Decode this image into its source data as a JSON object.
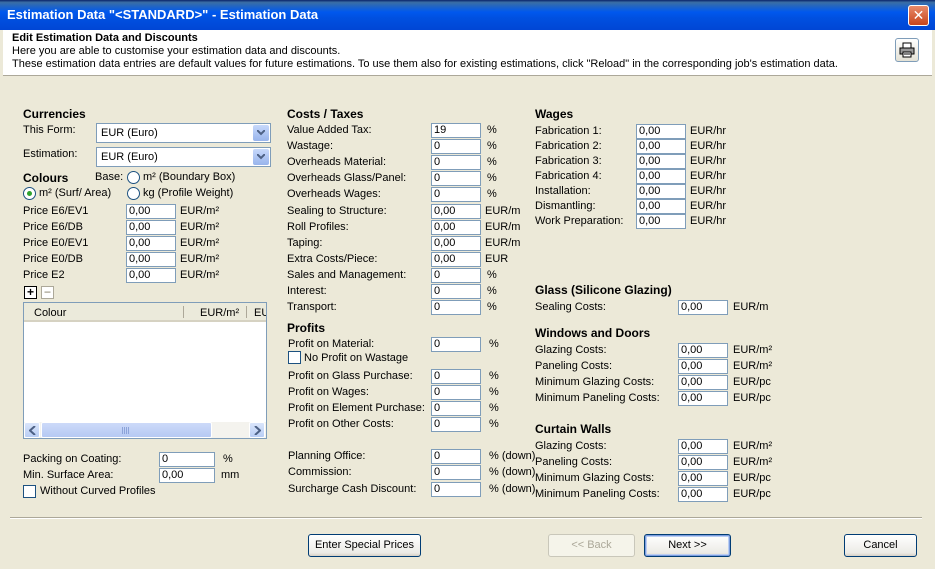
{
  "window": {
    "title": "Estimation Data \"<STANDARD>\" - Estimation Data",
    "close_glyph": "✕"
  },
  "header": {
    "title": "Edit Estimation Data and Discounts",
    "line1": "Here you are able to customise your estimation data and discounts.",
    "line2": "These estimation data entries are default values for future estimations. To use them also for existing estimations, click \"Reload\" in the corresponding job's estimation data."
  },
  "currencies": {
    "heading": "Currencies",
    "this_form_label": "This Form:",
    "this_form_value": "EUR (Euro)",
    "estimation_label": "Estimation:",
    "estimation_value": "EUR (Euro)"
  },
  "colours": {
    "heading": "Colours",
    "base_label": "Base:",
    "opt_boundary_box": "m² (Boundary Box)",
    "opt_surf_area": "m² (Surf/ Area)",
    "opt_profile_weight": "kg (Profile Weight)",
    "selected": "m² (Surf/ Area)",
    "prices": [
      {
        "label": "Price E6/EV1",
        "value": "0,00",
        "unit": "EUR/m²"
      },
      {
        "label": "Price E6/DB",
        "value": "0,00",
        "unit": "EUR/m²"
      },
      {
        "label": "Price E0/EV1",
        "value": "0,00",
        "unit": "EUR/m²"
      },
      {
        "label": "Price E0/DB",
        "value": "0,00",
        "unit": "EUR/m²"
      },
      {
        "label": "Price E2",
        "value": "0,00",
        "unit": "EUR/m²"
      }
    ],
    "add_glyph": "+",
    "remove_glyph": "−",
    "list_columns": [
      "Colour",
      "EUR/m²",
      "EU"
    ],
    "packing_label": "Packing on Coating:",
    "packing_value": "0",
    "packing_unit": "%",
    "min_surface_label": "Min. Surface Area:",
    "min_surface_value": "0,00",
    "min_surface_unit": "mm",
    "without_curved_label": "Without Curved Profiles"
  },
  "costs": {
    "heading": "Costs / Taxes",
    "rows": [
      {
        "label": "Value Added Tax:",
        "value": "19",
        "unit": "%"
      },
      {
        "label": "Wastage:",
        "value": "0",
        "unit": "%"
      },
      {
        "label": "Overheads Material:",
        "value": "0",
        "unit": "%"
      },
      {
        "label": "Overheads Glass/Panel:",
        "value": "0",
        "unit": "%"
      },
      {
        "label": "Overheads Wages:",
        "value": "0",
        "unit": "%"
      },
      {
        "label": "Sealing to Structure:",
        "value": "0,00",
        "unit": "EUR/m"
      },
      {
        "label": "Roll Profiles:",
        "value": "0,00",
        "unit": "EUR/m"
      },
      {
        "label": "Taping:",
        "value": "0,00",
        "unit": "EUR/m"
      },
      {
        "label": "Extra Costs/Piece:",
        "value": "0,00",
        "unit": "EUR"
      },
      {
        "label": "Sales and Management:",
        "value": "0",
        "unit": "%"
      },
      {
        "label": "Interest:",
        "value": "0",
        "unit": "%"
      },
      {
        "label": "Transport:",
        "value": "0",
        "unit": "%"
      }
    ]
  },
  "profits": {
    "heading": "Profits",
    "material_label": "Profit on Material:",
    "material_value": "0",
    "material_unit": "%",
    "no_profit_wastage_label": "No Profit on Wastage",
    "rows": [
      {
        "label": "Profit on Glass Purchase:",
        "value": "0",
        "unit": "%"
      },
      {
        "label": "Profit on Wages:",
        "value": "0",
        "unit": "%"
      },
      {
        "label": "Profit on Element Purchase:",
        "value": "0",
        "unit": "%"
      },
      {
        "label": "Profit on Other Costs:",
        "value": "0",
        "unit": "%"
      }
    ],
    "lower_rows": [
      {
        "label": "Planning Office:",
        "value": "0",
        "unit": "% (down)"
      },
      {
        "label": "Commission:",
        "value": "0",
        "unit": "% (down)"
      },
      {
        "label": "Surcharge Cash Discount:",
        "value": "0",
        "unit": "% (down)"
      }
    ]
  },
  "wages": {
    "heading": "Wages",
    "rows": [
      {
        "label": "Fabrication 1:",
        "value": "0,00",
        "unit": "EUR/hr"
      },
      {
        "label": "Fabrication 2:",
        "value": "0,00",
        "unit": "EUR/hr"
      },
      {
        "label": "Fabrication 3:",
        "value": "0,00",
        "unit": "EUR/hr"
      },
      {
        "label": "Fabrication 4:",
        "value": "0,00",
        "unit": "EUR/hr"
      },
      {
        "label": "Installation:",
        "value": "0,00",
        "unit": "EUR/hr"
      },
      {
        "label": "Dismantling:",
        "value": "0,00",
        "unit": "EUR/hr"
      },
      {
        "label": "Work Preparation:",
        "value": "0,00",
        "unit": "EUR/hr"
      }
    ]
  },
  "glass": {
    "heading": "Glass (Silicone Glazing)",
    "rows": [
      {
        "label": "Sealing Costs:",
        "value": "0,00",
        "unit": "EUR/m"
      }
    ]
  },
  "windows_doors": {
    "heading": "Windows and Doors",
    "rows": [
      {
        "label": "Glazing Costs:",
        "value": "0,00",
        "unit": "EUR/m²"
      },
      {
        "label": "Paneling Costs:",
        "value": "0,00",
        "unit": "EUR/m²"
      },
      {
        "label": "Minimum Glazing Costs:",
        "value": "0,00",
        "unit": "EUR/pc"
      },
      {
        "label": "Minimum Paneling Costs:",
        "value": "0,00",
        "unit": "EUR/pc"
      }
    ]
  },
  "curtain_walls": {
    "heading": "Curtain Walls",
    "rows": [
      {
        "label": "Glazing Costs:",
        "value": "0,00",
        "unit": "EUR/m²"
      },
      {
        "label": "Paneling Costs:",
        "value": "0,00",
        "unit": "EUR/m²"
      },
      {
        "label": "Minimum Glazing Costs:",
        "value": "0,00",
        "unit": "EUR/pc"
      },
      {
        "label": "Minimum Paneling Costs:",
        "value": "0,00",
        "unit": "EUR/pc"
      }
    ]
  },
  "buttons": {
    "special_prices": "Enter Special Prices",
    "back": "<< Back",
    "next": "Next >>",
    "cancel": "Cancel"
  }
}
